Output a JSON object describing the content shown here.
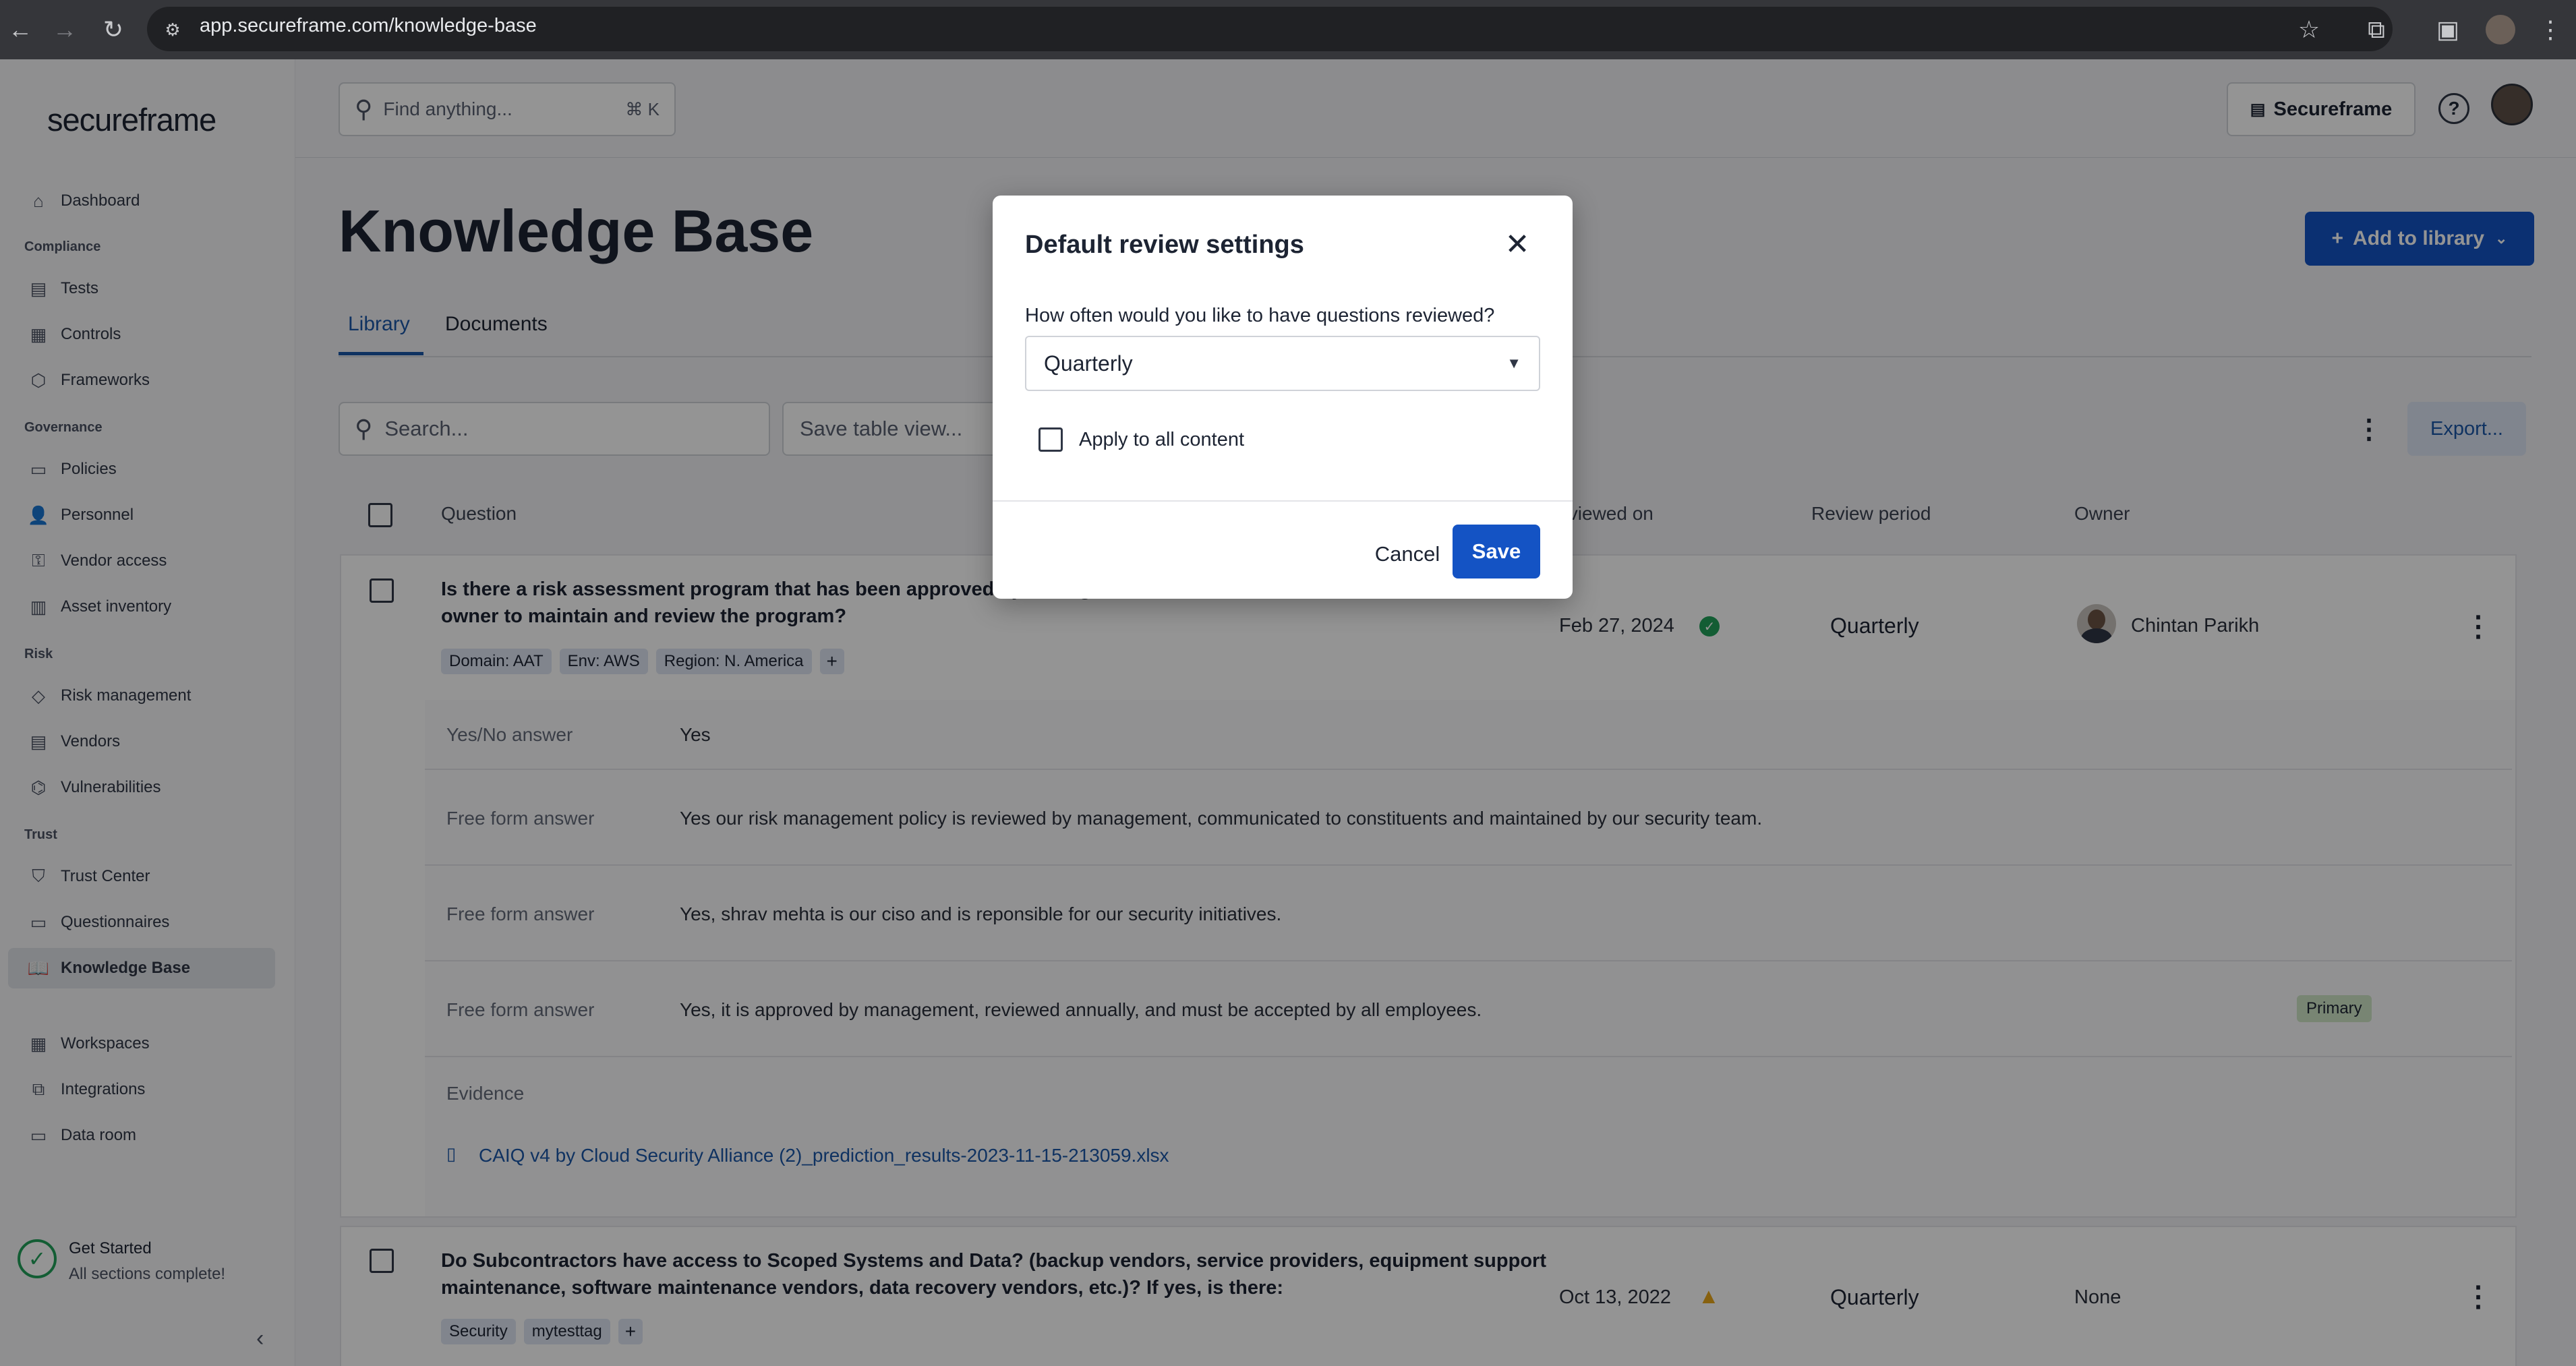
{
  "browser": {
    "url": "app.secureframe.com/knowledge-base"
  },
  "sidebar": {
    "logo": "secureframe",
    "items": [
      {
        "label": "Dashboard",
        "icon": "home-icon"
      },
      {
        "section": "Compliance"
      },
      {
        "label": "Tests",
        "icon": "clipboard-icon"
      },
      {
        "label": "Controls",
        "icon": "grid-icon"
      },
      {
        "label": "Frameworks",
        "icon": "cube-icon"
      },
      {
        "section": "Governance"
      },
      {
        "label": "Policies",
        "icon": "document-icon"
      },
      {
        "label": "Personnel",
        "icon": "people-icon"
      },
      {
        "label": "Vendor access",
        "icon": "key-icon"
      },
      {
        "label": "Asset inventory",
        "icon": "inventory-icon"
      },
      {
        "section": "Risk"
      },
      {
        "label": "Risk management",
        "icon": "diamond-icon"
      },
      {
        "label": "Vendors",
        "icon": "store-icon"
      },
      {
        "label": "Vulnerabilities",
        "icon": "bug-icon"
      },
      {
        "section": "Trust"
      },
      {
        "label": "Trust Center",
        "icon": "shield-icon"
      },
      {
        "label": "Questionnaires",
        "icon": "form-icon"
      },
      {
        "label": "Knowledge Base",
        "icon": "book-icon",
        "active": true
      },
      {
        "label": "Workspaces",
        "icon": "building-icon"
      },
      {
        "label": "Integrations",
        "icon": "plug-icon"
      },
      {
        "label": "Data room",
        "icon": "folder-icon"
      }
    ],
    "get_started": {
      "title": "Get Started",
      "subtitle": "All sections complete!"
    }
  },
  "header": {
    "search_placeholder": "Find anything...",
    "shortcut": "⌘ K",
    "workspace_button": "Secureframe"
  },
  "page": {
    "title": "Knowledge Base",
    "add_button": "Add to library",
    "tabs": [
      "Library",
      "Documents"
    ],
    "search_placeholder": "Search...",
    "save_view": "Save table view...",
    "export": "Export...",
    "columns": {
      "question": "Question",
      "reviewed_on": "Reviewed on",
      "review_period": "Review period",
      "owner": "Owner"
    }
  },
  "rows": [
    {
      "question_line1": "Is there a risk assessment program that has been approved by management, communicated to constituents and an",
      "question_line2": "owner to maintain and review the program?",
      "tags": [
        "Domain: AAT",
        "Env: AWS",
        "Region: N. America"
      ],
      "reviewed_on": "Feb 27, 2024",
      "status": "ok",
      "period": "Quarterly",
      "owner": "Chintan Parikh",
      "answers": [
        {
          "label": "Yes/No answer",
          "text": "Yes"
        },
        {
          "label": "Free form answer",
          "text": "Yes our risk management policy is reviewed by management, communicated to constituents and maintained by our security team."
        },
        {
          "label": "Free form answer",
          "text": "Yes, shrav mehta is our ciso and is reponsible for our security initiatives."
        },
        {
          "label": "Free form answer",
          "text": "Yes, it is approved by management, reviewed annually, and must be accepted by all employees.",
          "badge": "Primary"
        }
      ],
      "evidence_label": "Evidence",
      "evidence_file": "CAIQ v4 by Cloud Security Alliance (2)_prediction_results-2023-11-15-213059.xlsx"
    },
    {
      "question_line1": "Do Subcontractors have access to Scoped Systems and Data? (backup vendors, service providers, equipment support",
      "question_line2": "maintenance, software maintenance vendors, data recovery vendors, etc.)? If yes, is there:",
      "tags": [
        "Security",
        "mytesttag"
      ],
      "reviewed_on": "Oct 13, 2022",
      "status": "warning",
      "period": "Quarterly",
      "owner": "None"
    }
  ],
  "modal": {
    "title": "Default review settings",
    "question": "How often would you like to have questions reviewed?",
    "selected": "Quarterly",
    "checkbox_label": "Apply to all content",
    "cancel": "Cancel",
    "save": "Save"
  },
  "colors": {
    "accent": "#1453c4",
    "active_tab": "#1a56a8",
    "tag_bg": "#dfe6f3",
    "primary_badge": "#cfe6c7",
    "success": "#22a05a",
    "warning": "#e9a71b"
  }
}
